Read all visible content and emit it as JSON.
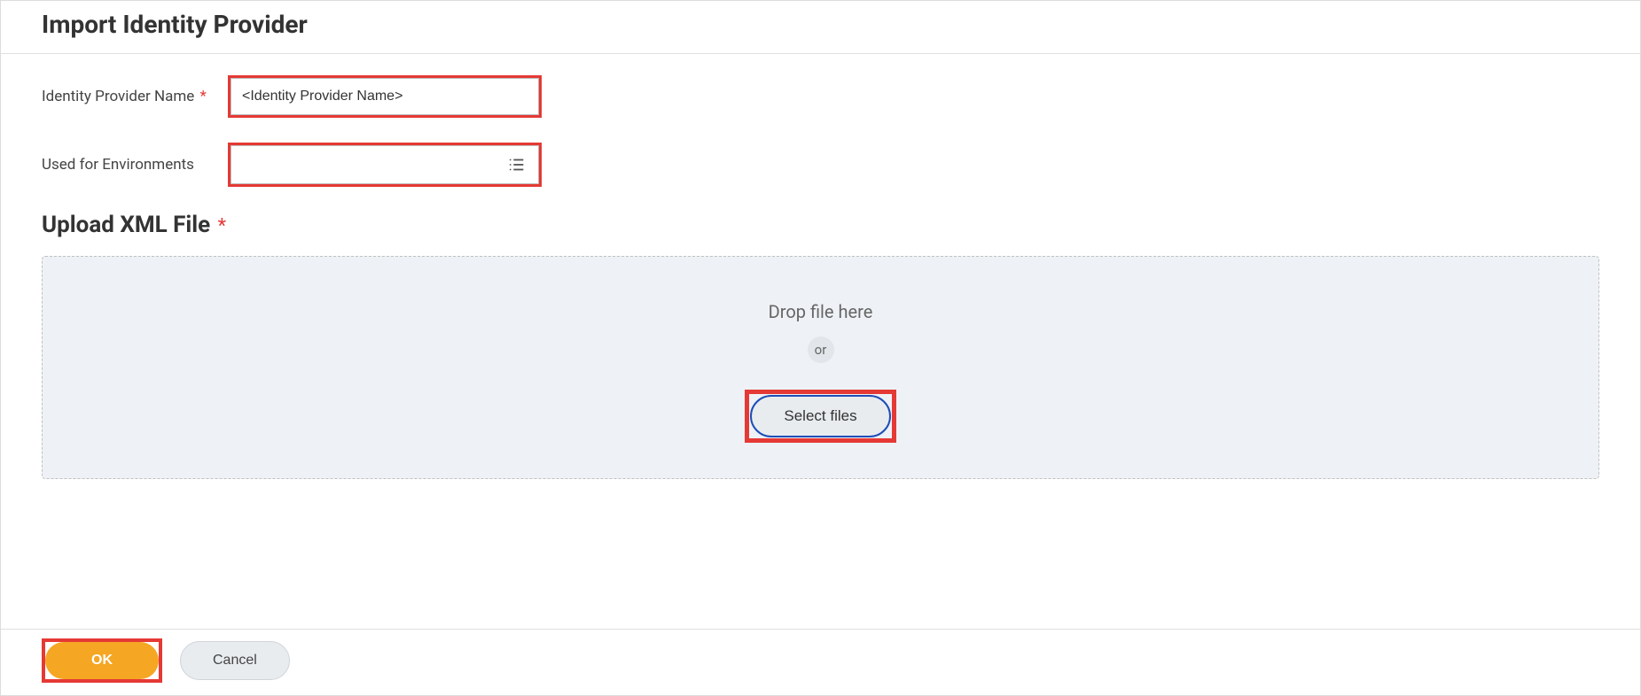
{
  "header": {
    "title": "Import Identity Provider"
  },
  "form": {
    "idp_name_label": "Identity Provider Name",
    "idp_name_value": "<Identity Provider Name>",
    "environments_label": "Used for Environments",
    "environments_value": "",
    "required_mark": "*"
  },
  "upload": {
    "section_title": "Upload XML File",
    "drop_text": "Drop file here",
    "or_text": "or",
    "select_files_label": "Select files"
  },
  "footer": {
    "ok_label": "OK",
    "cancel_label": "Cancel"
  }
}
